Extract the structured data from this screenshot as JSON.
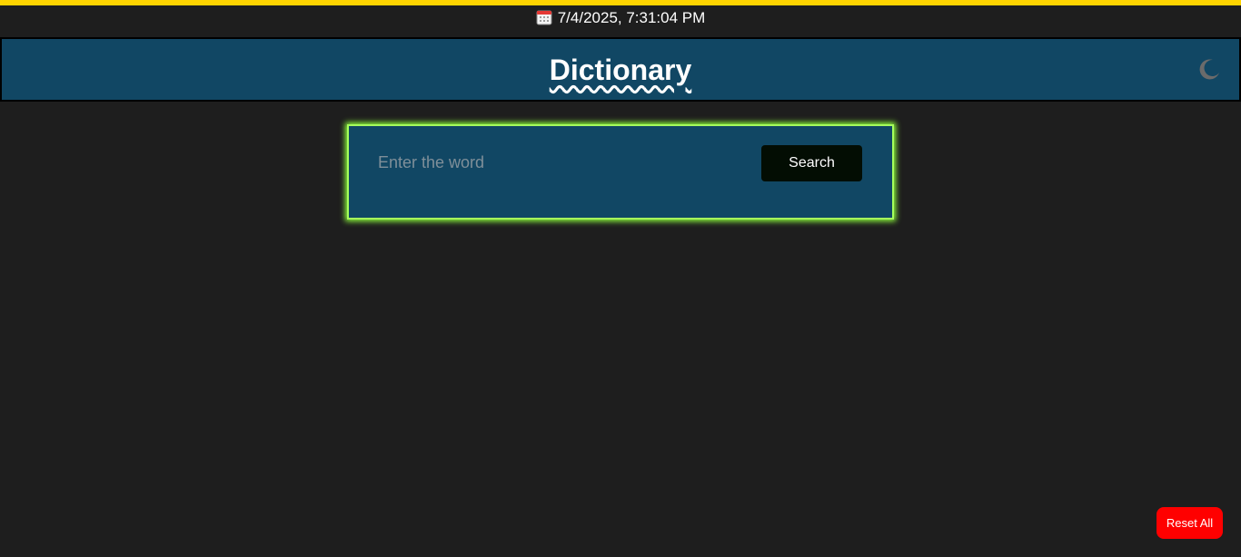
{
  "datetime": {
    "icon": "calendar-icon",
    "text": "7/4/2025, 7:31:04 PM"
  },
  "header": {
    "title": "Dictionary",
    "theme_toggle_icon": "moon-icon"
  },
  "search": {
    "placeholder": "Enter the word",
    "value": "",
    "button_label": "Search"
  },
  "reset_button_label": "Reset All",
  "colors": {
    "accent_bar": "#ffd400",
    "header_bg": "#114764",
    "card_glow": "#a6ff5c",
    "reset_bg": "#ff0000",
    "page_bg": "#1e1e1e"
  }
}
